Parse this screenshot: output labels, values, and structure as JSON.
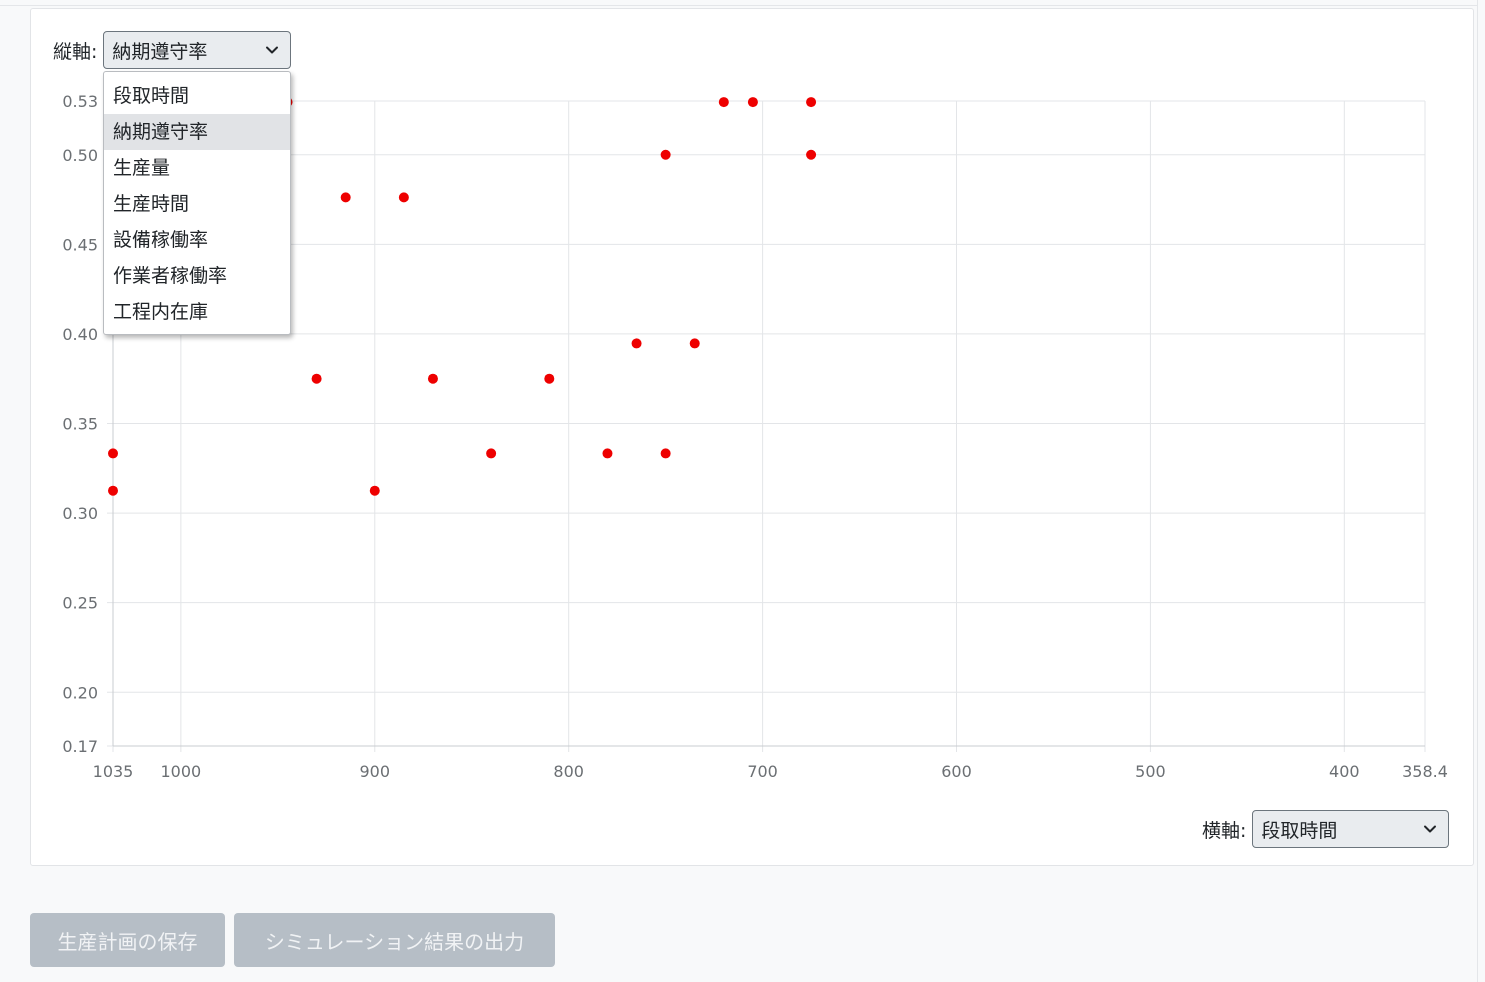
{
  "y_axis": {
    "label": "縦軸:",
    "selected": "納期遵守率"
  },
  "x_axis": {
    "label": "横軸:",
    "selected": "段取時間"
  },
  "dropdown_options": [
    "段取時間",
    "納期遵守率",
    "生産量",
    "生産時間",
    "設備稼働率",
    "作業者稼働率",
    "工程内在庫"
  ],
  "dropdown_highlighted_index": 1,
  "chart_data": {
    "type": "scatter",
    "xlim": [
      1035,
      358.4
    ],
    "ylim": [
      0.17,
      0.53
    ],
    "x_reversed": true,
    "x_ticks": [
      1035,
      1000,
      900,
      800,
      700,
      600,
      500,
      400,
      358.4
    ],
    "x_tick_labels": [
      "1035",
      "1000",
      "900",
      "800",
      "700",
      "600",
      "500",
      "400",
      "358.4"
    ],
    "y_ticks": [
      0.17,
      0.2,
      0.25,
      0.3,
      0.35,
      0.4,
      0.45,
      0.5,
      0.53
    ],
    "y_tick_labels": [
      "0.17",
      "0.20",
      "0.25",
      "0.30",
      "0.35",
      "0.40",
      "0.45",
      "0.50",
      "0.53"
    ],
    "grid": true,
    "point_color": "#ee0000",
    "points": [
      {
        "x": 1035,
        "y": 0.3333
      },
      {
        "x": 1035,
        "y": 0.3125
      },
      {
        "x": 945,
        "y": 0.5294
      },
      {
        "x": 930,
        "y": 0.375
      },
      {
        "x": 915,
        "y": 0.4762
      },
      {
        "x": 900,
        "y": 0.3125
      },
      {
        "x": 885,
        "y": 0.4762
      },
      {
        "x": 870,
        "y": 0.375
      },
      {
        "x": 840,
        "y": 0.3333
      },
      {
        "x": 810,
        "y": 0.375
      },
      {
        "x": 780,
        "y": 0.3333
      },
      {
        "x": 765,
        "y": 0.3947
      },
      {
        "x": 750,
        "y": 0.5
      },
      {
        "x": 750,
        "y": 0.3333
      },
      {
        "x": 735,
        "y": 0.3947
      },
      {
        "x": 720,
        "y": 0.5294
      },
      {
        "x": 705,
        "y": 0.5294
      },
      {
        "x": 675,
        "y": 0.5294
      },
      {
        "x": 675,
        "y": 0.5
      }
    ]
  },
  "buttons": {
    "save_plan": "生産計画の保存",
    "export_results": "シミュレーション結果の出力"
  }
}
